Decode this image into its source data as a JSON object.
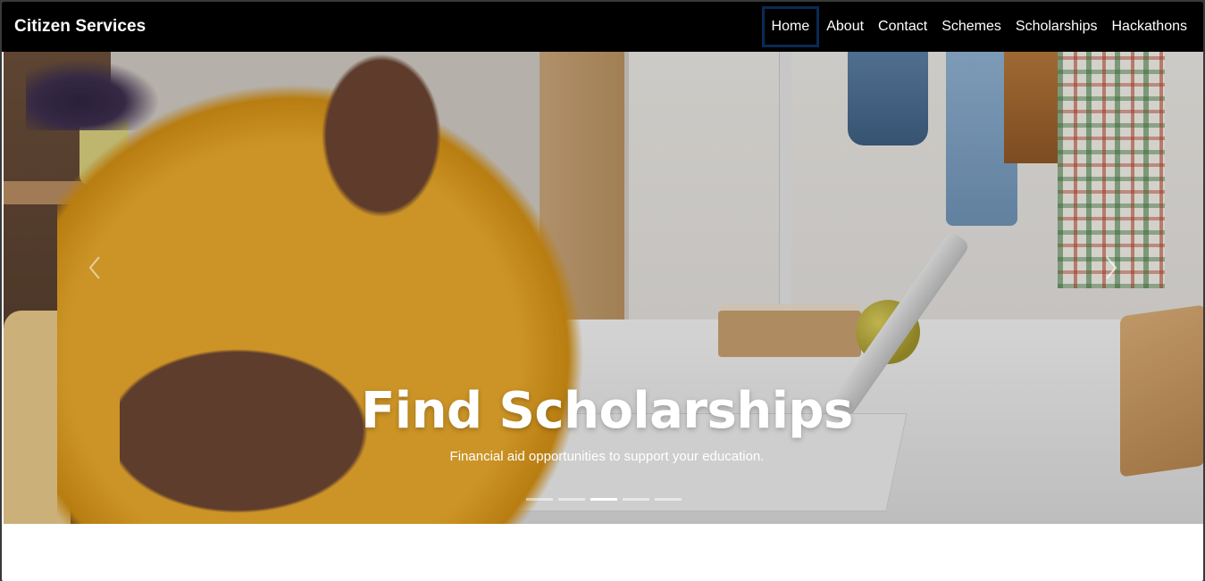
{
  "navbar": {
    "brand": "Citizen Services",
    "links": [
      "Home",
      "About",
      "Contact",
      "Schemes",
      "Scholarships",
      "Hackathons"
    ],
    "active": "Home"
  },
  "hero": {
    "title": "Find Scholarships",
    "subtitle": "Financial aid opportunities to support your education.",
    "slides_count": 5,
    "active_slide_index": 2,
    "prev_icon": "chevron-left-icon",
    "next_icon": "chevron-right-icon"
  },
  "colors": {
    "navbar_bg": "#000000",
    "active_border": "#0b2a55",
    "text": "#ffffff"
  }
}
